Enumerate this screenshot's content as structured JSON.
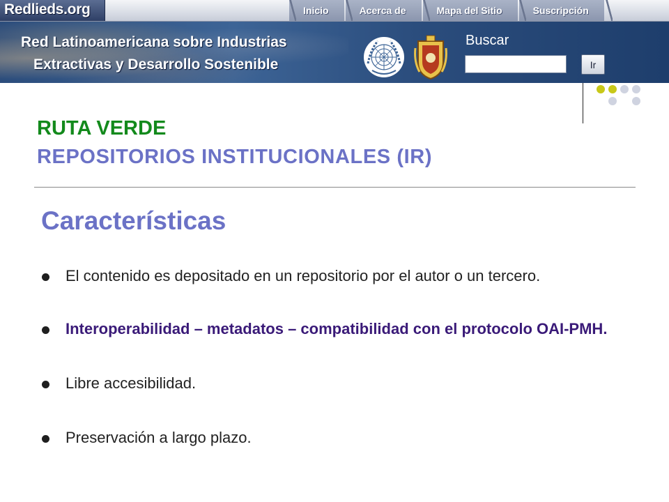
{
  "nav": {
    "logo_text": "Redlieds.org",
    "tabs": [
      "Inicio",
      "Acerca de",
      "Mapa del Sitio",
      "Suscripción"
    ]
  },
  "banner": {
    "line1": "Red Latinoamericana sobre Industrias",
    "line2": "Extractivas y Desarrollo Sostenible",
    "un_emblem_icon": "un-emblem-icon",
    "crest_icon": "crest-icon"
  },
  "search": {
    "label": "Buscar",
    "value": "",
    "button_label": "Ir"
  },
  "slide": {
    "title": "RUTA VERDE",
    "subtitle": "REPOSITORIOS INSTITUCIONALES (IR)",
    "section_heading": "Características",
    "bullets": [
      "El contenido es depositado en un repositorio por el autor o un tercero.",
      "Interoperabilidad – metadatos – compatibilidad con el protocolo OAI-PMH.",
      "Libre accesibilidad.",
      "Preservación a largo plazo."
    ]
  },
  "colors": {
    "title_green": "#138a1c",
    "subtitle_lavender": "#6b72c6",
    "bullet_purple": "#3a1a78",
    "dot_olive": "#c8c818",
    "dot_gray": "#cfd3e0"
  }
}
